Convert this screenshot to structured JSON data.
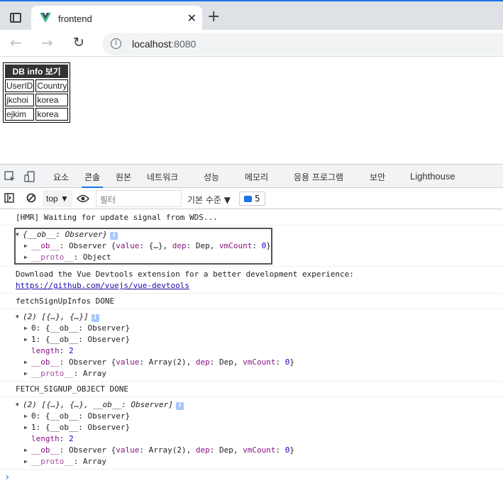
{
  "browser": {
    "tab_title": "frontend",
    "tab_close": "✕",
    "new_tab": "+",
    "url_host": "localhost",
    "url_port": ":8080",
    "info_icon": "i"
  },
  "page": {
    "table_header": "DB info 보기",
    "columns": [
      "UserID",
      "Country"
    ],
    "rows": [
      [
        "jkchoi",
        "korea"
      ],
      [
        "ejkim",
        "korea"
      ]
    ]
  },
  "devtools": {
    "tabs": [
      "요소",
      "콘솔",
      "원본",
      "네트워크",
      "성능",
      "메모리",
      "응용 프로그램",
      "보안",
      "Lighthouse"
    ],
    "active_tab": "콘솔",
    "context": "top ▼",
    "filter_placeholder": "필터",
    "levels": "기본 수준 ▼",
    "issues_count": "5"
  },
  "console": {
    "hmr": "[HMR] Waiting for update signal from WDS...",
    "obj1_summary_a": "{__ob__: Observer}",
    "obj1_ob_key": "__ob__",
    "obj1_ob_val_a": ": Observer {",
    "obj1_value_key": "value",
    "obj1_value_val": ": {…}, ",
    "obj1_dep_key": "dep",
    "obj1_dep_val": ": Dep, ",
    "obj1_vm_key": "vmCount",
    "obj1_vm_val": "0",
    "obj1_close": "}",
    "obj1_proto_key": "__proto__",
    "obj1_proto_val": ": Object",
    "devtools_msg": "Download the Vue Devtools extension for a better development experience:",
    "devtools_link": "https://github.com/vuejs/vue-devtools",
    "fetch1": "fetchSignUpInfos DONE",
    "arr1_summary": "(2) [{…}, {…}]",
    "arr1_item0": "0: {__ob__: Observer}",
    "arr1_item1": "1: {__ob__: Observer}",
    "length_key": "length",
    "length_val": "2",
    "ob_key": "__ob__",
    "ob_val_a": ": Observer {",
    "value_key": "value",
    "value_val": ": Array(2), ",
    "dep_key": "dep",
    "dep_val": ": Dep, ",
    "vm_key": "vmCount",
    "vm_val": "0",
    "close": "}",
    "proto_key": "__proto__",
    "proto_val": ": Array",
    "fetch2": "FETCH_SIGNUP_OBJECT DONE",
    "arr2_summary": "(2) [{…}, {…}, __ob__: Observer]",
    "arr2_item0": "0: {__ob__: Observer}",
    "arr2_item1": "1: {__ob__: Observer}",
    "prompt": "›"
  },
  "colors": {
    "accent": "#1a73e8",
    "vue_green": "#41b883",
    "vue_dark": "#35495e"
  }
}
